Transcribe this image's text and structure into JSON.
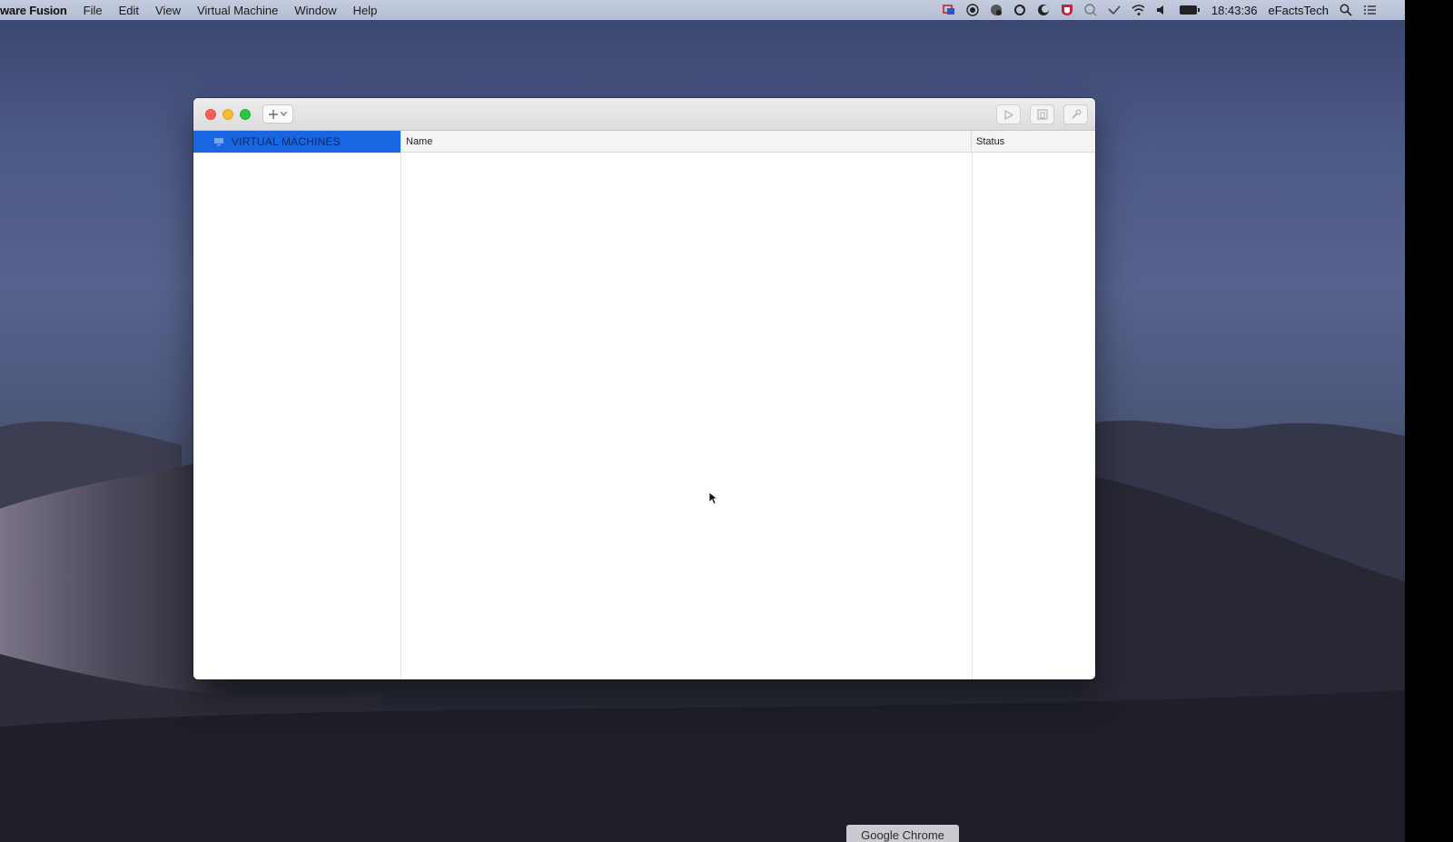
{
  "menubar": {
    "app_name": "ware Fusion",
    "items": [
      "File",
      "Edit",
      "View",
      "Virtual Machine",
      "Window",
      "Help"
    ],
    "clock": "18:43:36",
    "user": "eFactsTech"
  },
  "window": {
    "sidebar": {
      "items": [
        {
          "label": "VIRTUAL MACHINES",
          "selected": true
        }
      ]
    },
    "table": {
      "columns": [
        "Name",
        "Status"
      ],
      "rows": []
    }
  },
  "dock": {
    "tooltip": "Google Chrome"
  },
  "colors": {
    "selection": "#1866e1",
    "close": "#fc5f57",
    "minimize": "#fdbc2e",
    "zoom": "#28c840"
  }
}
